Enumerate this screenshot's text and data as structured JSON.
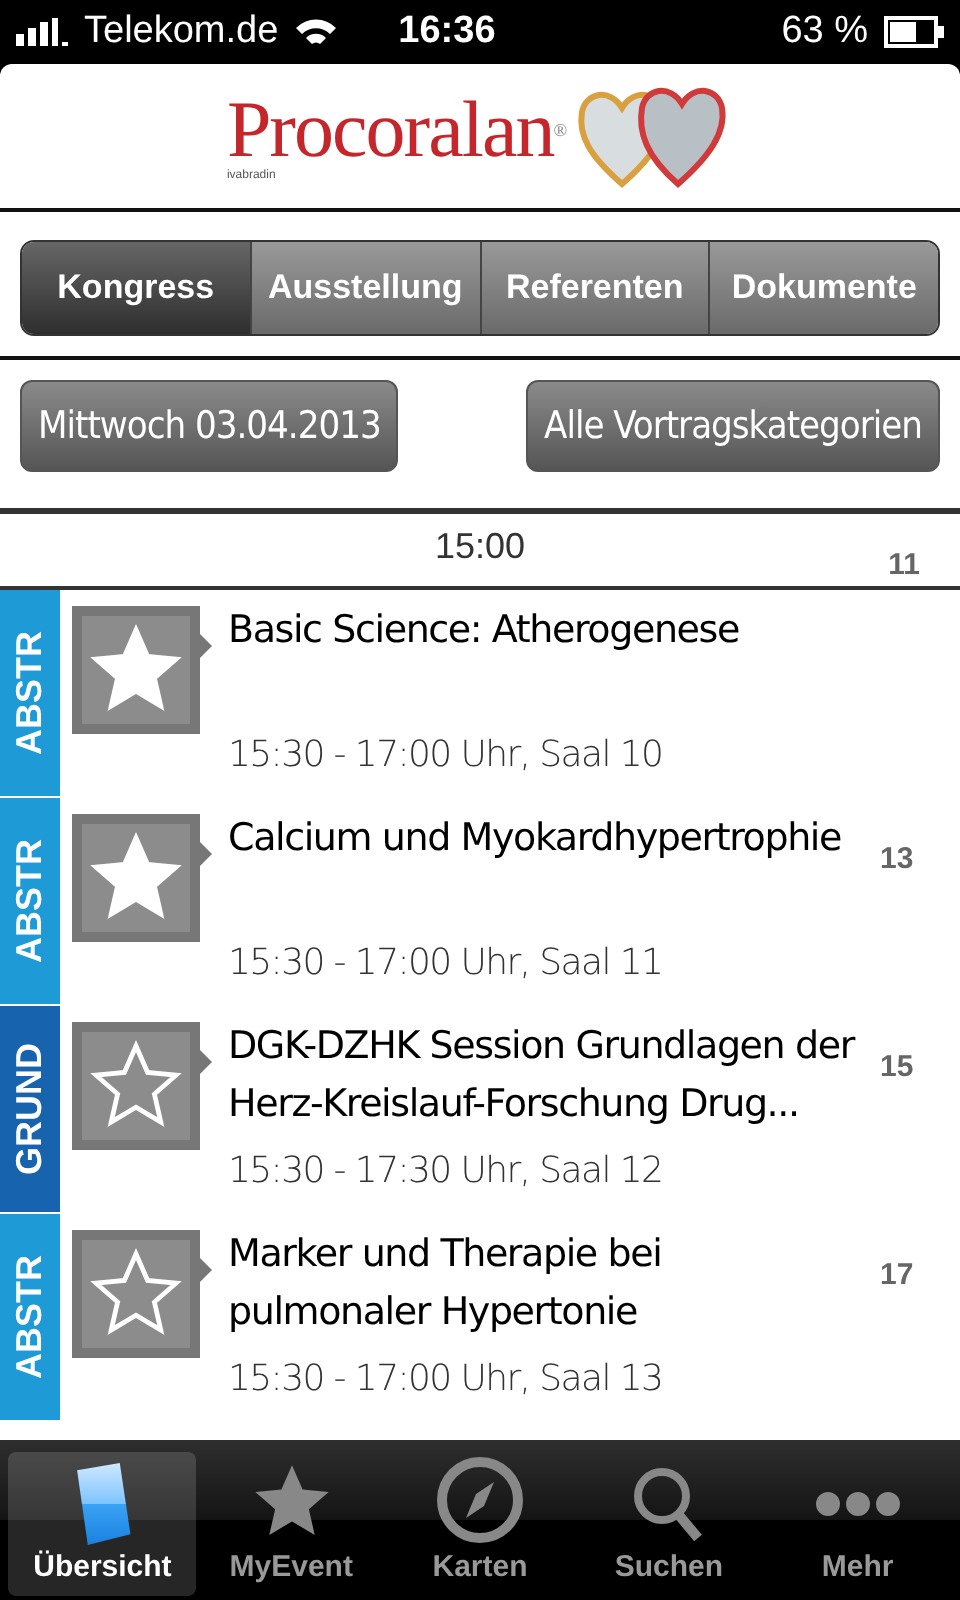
{
  "status_bar": {
    "carrier": "Telekom.de",
    "time": "16:36",
    "battery": "63 %"
  },
  "header": {
    "brand": "Procoralan$^{®}$",
    "subtitle": "ivabradin"
  },
  "segments": [
    {
      "label": "Kongress",
      "selected": true
    },
    {
      "label": "Ausstellung",
      "selected": false
    },
    {
      "label": "Referenten",
      "selected": false
    },
    {
      "label": "Dokumente",
      "selected": false
    }
  ],
  "filters": [
    "Mittwoch 03.04.2013",
    "Alle Vortragskategorien"
  ],
  "time_header": {
    "time": "15:00",
    "number": "11"
  },
  "sessions": [
    {
      "category": "ABSTR",
      "color": "#1e9ad6",
      "favorite": true,
      "title": "Basic Science: Atherogenese",
      "details": "15:30 - 17:00 Uhr, Saal 10"
    },
    {
      "category": "ABSTR",
      "color": "#1e9ad6",
      "favorite": true,
      "title": "Calcium und Myokardhypertrophie",
      "details": "15:30 - 17:00 Uhr, Saal 11",
      "number": "13"
    },
    {
      "category": "GRUND",
      "color": "#1763ad",
      "favorite": false,
      "title": "DGK-DZHK Session Grundlagen der Herz-Kreislauf-Forschung Drug...",
      "details": "15:30 - 17:30 Uhr, Saal 12",
      "number": "15"
    },
    {
      "category": "ABSTR",
      "color": "#1e9ad6",
      "favorite": false,
      "title": "Marker und Therapie bei pulmonaler Hypertonie",
      "details": "15:30 - 17:00 Uhr, Saal 13",
      "number": "17"
    }
  ],
  "tab_bar": [
    {
      "kind": "overview",
      "label": "Übersicht",
      "selected": true
    },
    {
      "kind": "star",
      "label": "MyEvent",
      "selected": false
    },
    {
      "kind": "compass",
      "label": "Karten",
      "selected": false
    },
    {
      "kind": "search",
      "label": "Suchen",
      "selected": false
    },
    {
      "kind": "more",
      "label": "Mehr",
      "selected": false
    }
  ]
}
